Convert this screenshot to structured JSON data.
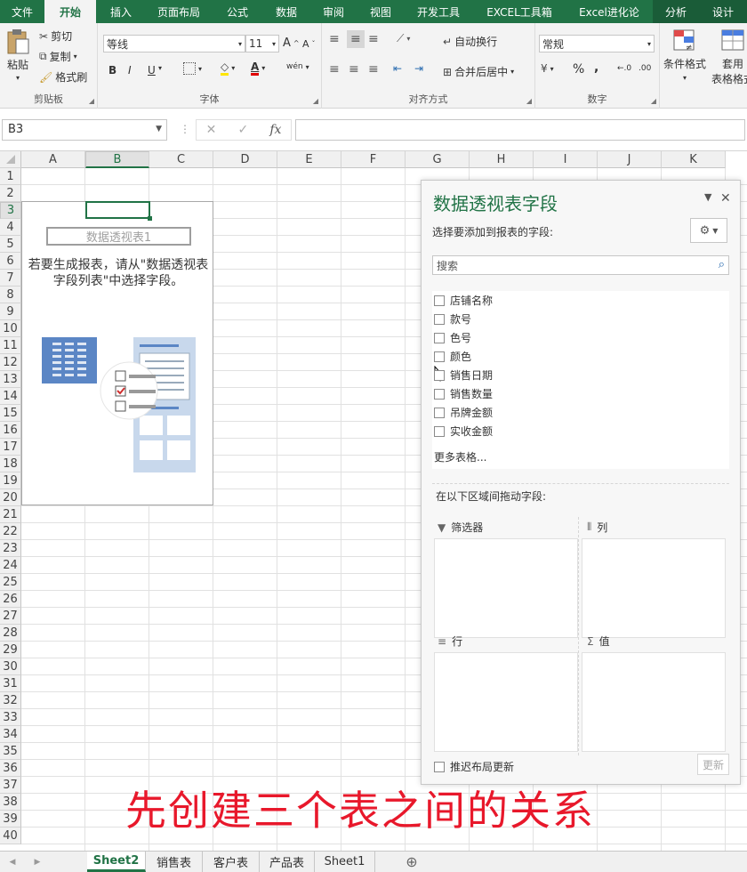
{
  "ribbon_tabs": [
    {
      "label": "文件",
      "active": false
    },
    {
      "label": "开始",
      "active": true
    },
    {
      "label": "插入",
      "active": false
    },
    {
      "label": "页面布局",
      "active": false
    },
    {
      "label": "公式",
      "active": false
    },
    {
      "label": "数据",
      "active": false
    },
    {
      "label": "审阅",
      "active": false
    },
    {
      "label": "视图",
      "active": false
    },
    {
      "label": "开发工具",
      "active": false
    },
    {
      "label": "EXCEL工具箱",
      "active": false
    },
    {
      "label": "Excel进化论",
      "active": false
    },
    {
      "label": "分析",
      "active": false
    },
    {
      "label": "设计",
      "active": false
    }
  ],
  "clipboard": {
    "paste": "粘贴",
    "cut": "剪切",
    "copy": "复制",
    "format_painter": "格式刷",
    "label": "剪贴板"
  },
  "font": {
    "family": "等线",
    "size": "11",
    "label": "字体",
    "bold": "B",
    "italic": "I",
    "underline": "U",
    "increase": "A",
    "decrease": "A",
    "color_letter": "A",
    "phonetic": "wén"
  },
  "alignment": {
    "wrap": "自动换行",
    "merge": "合并后居中",
    "label": "对齐方式"
  },
  "number": {
    "format": "常规",
    "percent": "%",
    "comma": ",",
    "label": "数字"
  },
  "styles": {
    "conditional": "条件格式",
    "table_format": "套用\n表格格式"
  },
  "formula_bar": {
    "name_box": "B3",
    "fx": "fx",
    "cancel": "✕",
    "enter": "✓",
    "value": ""
  },
  "columns": [
    "A",
    "B",
    "C",
    "D",
    "E",
    "F",
    "G",
    "H",
    "I",
    "J",
    "K"
  ],
  "selected_column": "B",
  "rows": [
    "1",
    "2",
    "3",
    "4",
    "5",
    "6",
    "7",
    "8",
    "9",
    "10",
    "11",
    "12",
    "13",
    "14",
    "15",
    "16",
    "17",
    "18",
    "19",
    "20",
    "21",
    "22",
    "23",
    "24",
    "25",
    "26",
    "27",
    "28",
    "29",
    "30",
    "31",
    "32",
    "33",
    "34",
    "35",
    "36",
    "37",
    "38",
    "39",
    "40"
  ],
  "selected_row": "3",
  "pivot_placeholder": {
    "name": "数据透视表1",
    "message": "若要生成报表，请从\"数据透视表字段列表\"中选择字段。"
  },
  "pivot_pane": {
    "title": "数据透视表字段",
    "choose_label": "选择要添加到报表的字段:",
    "search_placeholder": "搜索",
    "fields": [
      "店铺名称",
      "款号",
      "色号",
      "颜色",
      "销售日期",
      "销售数量",
      "吊牌金额",
      "实收金额"
    ],
    "more_tables": "更多表格...",
    "drag_label": "在以下区域间拖动字段:",
    "areas": {
      "filters": "筛选器",
      "columns": "列",
      "rows": "行",
      "values": "值"
    },
    "defer_label": "推迟布局更新",
    "update_button": "更新"
  },
  "sheet_tabs": [
    {
      "label": "Sheet2",
      "active": true
    },
    {
      "label": "销售表",
      "active": false
    },
    {
      "label": "客户表",
      "active": false
    },
    {
      "label": "产品表",
      "active": false
    },
    {
      "label": "Sheet1",
      "active": false
    }
  ],
  "caption": "先创建三个表之间的关系",
  "colors": {
    "excel_green": "#217346",
    "caption_red": "#e8182b"
  }
}
